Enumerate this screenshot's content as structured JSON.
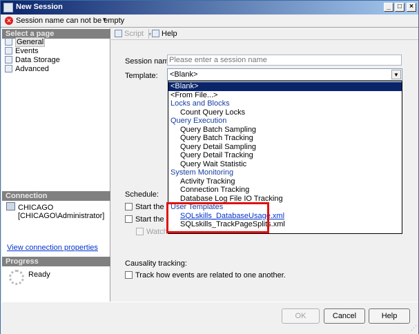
{
  "window": {
    "title": "New Session",
    "controls": {
      "minimize": "_",
      "maximize": "□",
      "close": "×"
    }
  },
  "message": {
    "icon": "error-icon",
    "text": "Session name can not be empty",
    "caret": "▾"
  },
  "left": {
    "select_page_header": "Select a page",
    "pages": [
      "General",
      "Events",
      "Data Storage",
      "Advanced"
    ],
    "connection_header": "Connection",
    "server": "CHICAGO",
    "user": "[CHICAGO\\Administrator]",
    "view_connection_link": "View connection properties",
    "progress_header": "Progress",
    "progress_status": "Ready"
  },
  "toolbar": {
    "script_label": "Script",
    "script_caret": "▾",
    "help_label": "Help"
  },
  "form": {
    "session_name_label": "Session name:",
    "session_name_placeholder": "Please enter a session name",
    "template_label": "Template:",
    "template_value": "<Blank>",
    "schedule_label": "Schedule:",
    "start_event_1": "Start the ev",
    "start_event_2": "Start the ev",
    "watch_label": "Watch l",
    "causality_label": "Causality tracking:",
    "causality_checkbox": "Track how events are related to one another."
  },
  "dropdown": {
    "items": [
      {
        "text": "<Blank>",
        "kind": "top",
        "selected": true
      },
      {
        "text": "<From File...>",
        "kind": "top"
      },
      {
        "text": "Locks and Blocks",
        "kind": "group"
      },
      {
        "text": "Count Query Locks",
        "kind": "sub"
      },
      {
        "text": "Query Execution",
        "kind": "group"
      },
      {
        "text": "Query Batch Sampling",
        "kind": "sub"
      },
      {
        "text": "Query Batch Tracking",
        "kind": "sub"
      },
      {
        "text": "Query Detail Sampling",
        "kind": "sub"
      },
      {
        "text": "Query Detail Tracking",
        "kind": "sub"
      },
      {
        "text": "Query Wait Statistic",
        "kind": "sub"
      },
      {
        "text": "System Monitoring",
        "kind": "group"
      },
      {
        "text": "Activity Tracking",
        "kind": "sub"
      },
      {
        "text": "Connection Tracking",
        "kind": "sub"
      },
      {
        "text": "Database Log File IO Tracking",
        "kind": "sub"
      },
      {
        "text": "User Templates",
        "kind": "group"
      },
      {
        "text": "SQLskills_DatabaseUsage.xml",
        "kind": "templ"
      },
      {
        "text": "SQLskills_TrackPageSplits.xml",
        "kind": "sub"
      }
    ]
  },
  "buttons": {
    "ok": "OK",
    "cancel": "Cancel",
    "help": "Help"
  }
}
